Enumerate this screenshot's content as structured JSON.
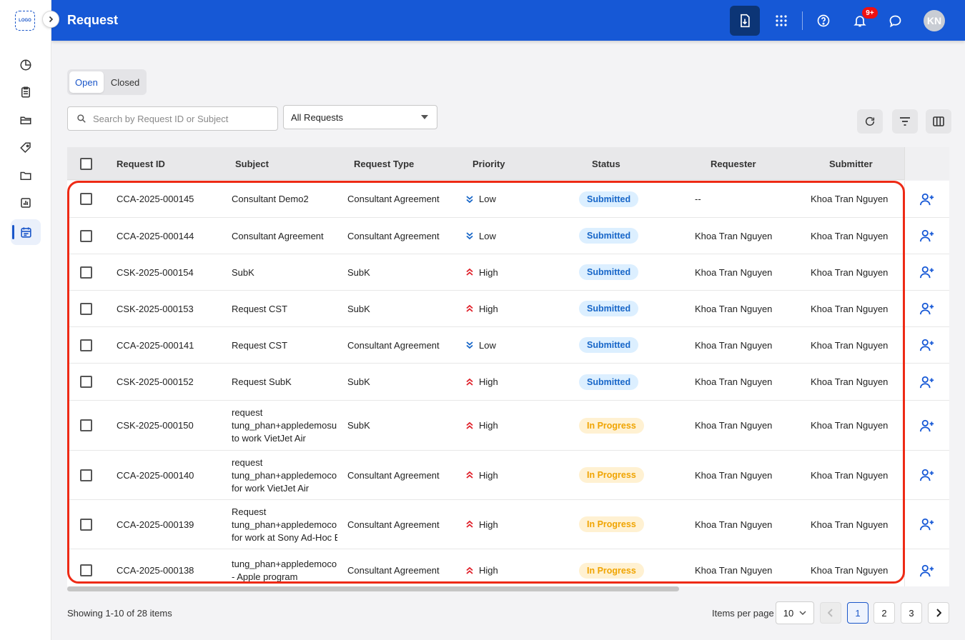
{
  "app": {
    "logo_text": "LOGO",
    "page_title": "Request"
  },
  "header": {
    "notification_count": "9+",
    "avatar_initials": "KN"
  },
  "tabs": [
    {
      "label": "Open",
      "active": true
    },
    {
      "label": "Closed",
      "active": false
    }
  ],
  "filters": {
    "search_placeholder": "Search by Request ID or Subject",
    "search_value": "",
    "request_filter": "All Requests"
  },
  "table": {
    "columns": [
      "Request ID",
      "Subject",
      "Request Type",
      "Priority",
      "Status",
      "Requester",
      "Submitter"
    ],
    "rows": [
      {
        "id": "CCA-2025-000145",
        "subject": [
          "Consultant Demo2"
        ],
        "type": "Consultant Agreement",
        "priority": "Low",
        "status": "Submitted",
        "requester": "--",
        "submitter": "Khoa Tran Nguyen"
      },
      {
        "id": "CCA-2025-000144",
        "subject": [
          "Consultant Agreement"
        ],
        "type": "Consultant Agreement",
        "priority": "Low",
        "status": "Submitted",
        "requester": "Khoa Tran Nguyen",
        "submitter": "Khoa Tran Nguyen"
      },
      {
        "id": "CSK-2025-000154",
        "subject": [
          "SubK"
        ],
        "type": "SubK",
        "priority": "High",
        "status": "Submitted",
        "requester": "Khoa Tran Nguyen",
        "submitter": "Khoa Tran Nguyen"
      },
      {
        "id": "CSK-2025-000153",
        "subject": [
          "Request CST"
        ],
        "type": "SubK",
        "priority": "High",
        "status": "Submitted",
        "requester": "Khoa Tran Nguyen",
        "submitter": "Khoa Tran Nguyen"
      },
      {
        "id": "CCA-2025-000141",
        "subject": [
          "Request CST"
        ],
        "type": "Consultant Agreement",
        "priority": "Low",
        "status": "Submitted",
        "requester": "Khoa Tran Nguyen",
        "submitter": "Khoa Tran Nguyen"
      },
      {
        "id": "CSK-2025-000152",
        "subject": [
          "Request SubK"
        ],
        "type": "SubK",
        "priority": "High",
        "status": "Submitted",
        "requester": "Khoa Tran Nguyen",
        "submitter": "Khoa Tran Nguyen"
      },
      {
        "id": "CSK-2025-000150",
        "subject": [
          "request",
          "tung_phan+appledemosub",
          "to work VietJet Air"
        ],
        "type": "SubK",
        "priority": "High",
        "status": "In Progress",
        "requester": "Khoa Tran Nguyen",
        "submitter": "Khoa Tran Nguyen"
      },
      {
        "id": "CCA-2025-000140",
        "subject": [
          "request",
          "tung_phan+appledemocon",
          "for work VietJet Air"
        ],
        "type": "Consultant Agreement",
        "priority": "High",
        "status": "In Progress",
        "requester": "Khoa Tran Nguyen",
        "submitter": "Khoa Tran Nguyen"
      },
      {
        "id": "CCA-2025-000139",
        "subject": [
          "Request",
          "tung_phan+appledemocon",
          "for work at Sony Ad-Hoc E"
        ],
        "type": "Consultant Agreement",
        "priority": "High",
        "status": "In Progress",
        "requester": "Khoa Tran Nguyen",
        "submitter": "Khoa Tran Nguyen"
      },
      {
        "id": "CCA-2025-000138",
        "subject": [
          "tung_phan+appledemocon",
          "- Apple program"
        ],
        "type": "Consultant Agreement",
        "priority": "High",
        "status": "In Progress",
        "requester": "Khoa Tran Nguyen",
        "submitter": "Khoa Tran Nguyen"
      }
    ]
  },
  "footer": {
    "showing_text": "Showing 1-10 of 28 items",
    "items_per_page_label": "Items per page",
    "items_per_page_value": "10",
    "pages": [
      "1",
      "2",
      "3"
    ],
    "current_page": "1"
  },
  "colors": {
    "header_bg": "#1658d6",
    "accent": "#1a56c9",
    "submitted_bg": "#dcefff",
    "submitted_text": "#1766c8",
    "in_progress_bg": "#fff1d2",
    "in_progress_text": "#f0a400",
    "priority_low": "#1766c8",
    "priority_high": "#e0202a",
    "highlight_border": "#ee2a15"
  },
  "icons": {
    "sidebar": [
      "dashboard-pie-icon",
      "clipboard-list-icon",
      "folder-open-icon",
      "tag-icon",
      "folder-icon",
      "bar-chart-icon",
      "calendar-list-icon"
    ],
    "header": [
      "download-document-icon",
      "apps-grid-icon",
      "help-icon",
      "bell-icon",
      "chat-icon"
    ],
    "row_action": "add-user-icon"
  }
}
